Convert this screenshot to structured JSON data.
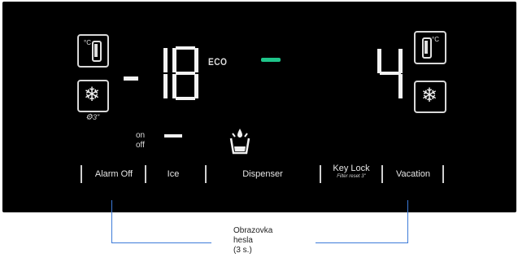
{
  "display": {
    "freezer_temp_sign": "-",
    "freezer_temp_value": "18",
    "eco_label": "ECO",
    "fridge_temp_value": "4",
    "onoff": {
      "on": "on",
      "off": "off"
    },
    "lock_hint": "3\""
  },
  "buttons": {
    "alarm_off": "Alarm Off",
    "ice": "Ice",
    "dispenser": "Dispenser",
    "key_lock": "Key Lock",
    "key_lock_sub": "Filter reset 3\"",
    "vacation": "Vacation"
  },
  "callout": {
    "text_line1": "Obrazovka",
    "text_line2": "hesla",
    "text_line3": "(3 s.)"
  },
  "colors": {
    "panel_bg": "#000000",
    "indicator_green": "#1fc58a",
    "callout_line": "#3d7bd9"
  }
}
